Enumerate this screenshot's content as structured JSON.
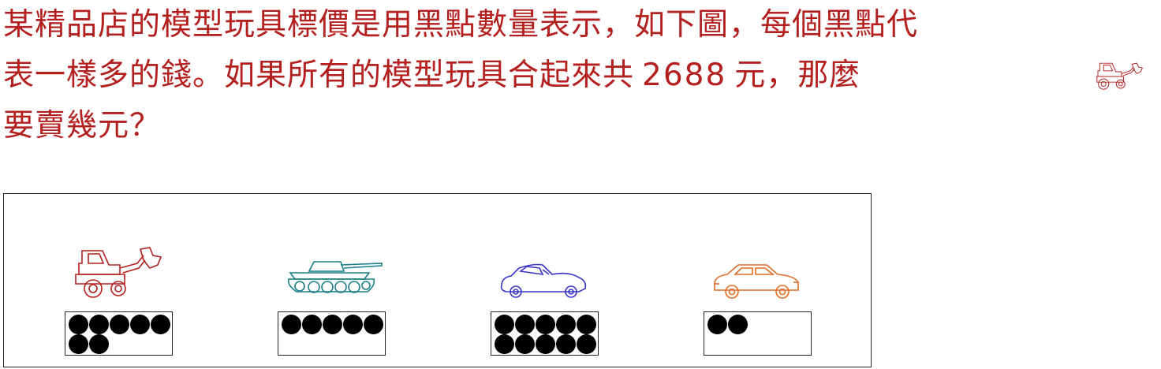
{
  "question": {
    "line1": "某精品店的模型玩具標價是用黑點數量表示，如下圖，每個黑點代",
    "line2_before": "表一樣多的錢。如果所有的模型玩具合起來共",
    "total": "2688",
    "line2_after": "元，那麼",
    "line3": "要賣幾元？",
    "inline_icon": "bulldozer-icon"
  },
  "toys": [
    {
      "name": "bulldozer",
      "icon": "bulldozer-icon",
      "color": "#b3201f",
      "dots": 7
    },
    {
      "name": "tank",
      "icon": "tank-icon",
      "color": "#1a7f86",
      "dots": 5
    },
    {
      "name": "sports-car",
      "icon": "sports-car-icon",
      "color": "#3a35c9",
      "dots": 10
    },
    {
      "name": "sedan",
      "icon": "sedan-icon",
      "color": "#e06b26",
      "dots": 2
    }
  ],
  "colors": {
    "question_text": "#b3201f",
    "dot": "#000000",
    "border": "#222222"
  }
}
